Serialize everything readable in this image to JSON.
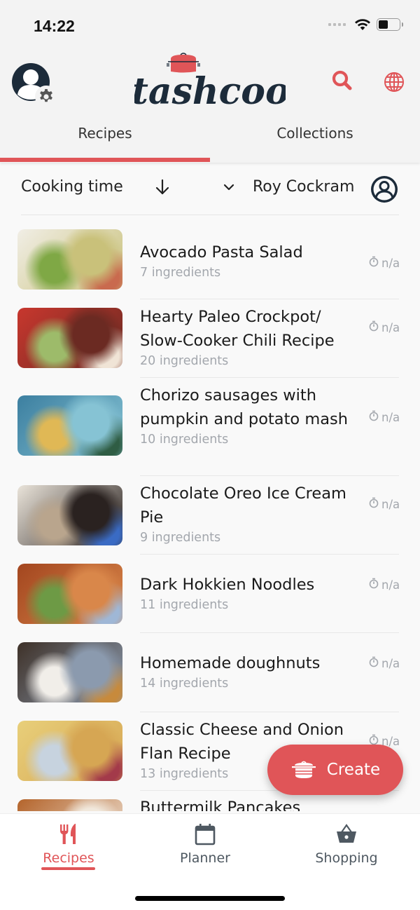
{
  "status_bar": {
    "time": "14:22",
    "battery_level": 0.45
  },
  "header": {
    "logo_text": "Stashcook",
    "icons": {
      "profile": "user-circle-icon",
      "settings": "gear-icon",
      "search": "search-icon",
      "language": "globe-icon"
    }
  },
  "colors": {
    "accent": "#e05558",
    "navy": "#1c2b3a",
    "muted_text": "#a3a7ad",
    "nav_inactive": "#4e5861"
  },
  "tabs": [
    {
      "label": "Recipes",
      "active": true
    },
    {
      "label": "Collections",
      "active": false
    }
  ],
  "filter": {
    "sort_label": "Cooking time",
    "sort_direction": "descending",
    "user_name": "Roy Cockram"
  },
  "recipes": [
    {
      "title": "Avocado Pasta Salad",
      "ingredients": "7 ingredients",
      "time": "n/a",
      "thumb_colors": [
        "#f1eee6",
        "#c9c17a",
        "#7fa845",
        "#c96a4e"
      ]
    },
    {
      "title": "Hearty Paleo Crockpot/ Slow-Cooker Chili Recipe",
      "ingredients": "20 ingredients",
      "time": "n/a",
      "thumb_colors": [
        "#c8372e",
        "#6b2a22",
        "#9dbb6a",
        "#f0e4d6"
      ]
    },
    {
      "title": "Chorizo sausages with pumpkin and potato mash",
      "ingredients": "10 ingredients",
      "time": "n/a",
      "thumb_colors": [
        "#3c7fa0",
        "#86c3d4",
        "#e0b855",
        "#2f5d44"
      ]
    },
    {
      "title": "Chocolate Oreo Ice Cream Pie",
      "ingredients": "9 ingredients",
      "time": "n/a",
      "thumb_colors": [
        "#eae4da",
        "#2a2220",
        "#b9a58d",
        "#3a6bc4"
      ]
    },
    {
      "title": "Dark Hokkien Noodles",
      "ingredients": "11 ingredients",
      "time": "n/a",
      "thumb_colors": [
        "#a3461f",
        "#d9874a",
        "#6d9a45",
        "#9fb7d6"
      ]
    },
    {
      "title": "Homemade doughnuts",
      "ingredients": "14 ingredients",
      "time": "n/a",
      "thumb_colors": [
        "#3e3128",
        "#8b9aae",
        "#f1eee9",
        "#c78a3c"
      ]
    },
    {
      "title": "Classic Cheese and Onion Flan Recipe",
      "ingredients": "13 ingredients",
      "time": "n/a",
      "thumb_colors": [
        "#e8cf7a",
        "#d6a653",
        "#c7d3df",
        "#a33a4a"
      ]
    },
    {
      "title": "Buttermilk Pancakes",
      "ingredients": "",
      "time": "",
      "thumb_colors": [
        "#b4642b",
        "#f1e8dc",
        "#d8a15b",
        "#7a3a1a"
      ]
    }
  ],
  "fab": {
    "label": "Create",
    "icon": "pot-icon"
  },
  "bottom_nav": [
    {
      "label": "Recipes",
      "icon": "fork-knife-icon",
      "active": true
    },
    {
      "label": "Planner",
      "icon": "calendar-icon",
      "active": false
    },
    {
      "label": "Shopping",
      "icon": "basket-icon",
      "active": false
    }
  ]
}
